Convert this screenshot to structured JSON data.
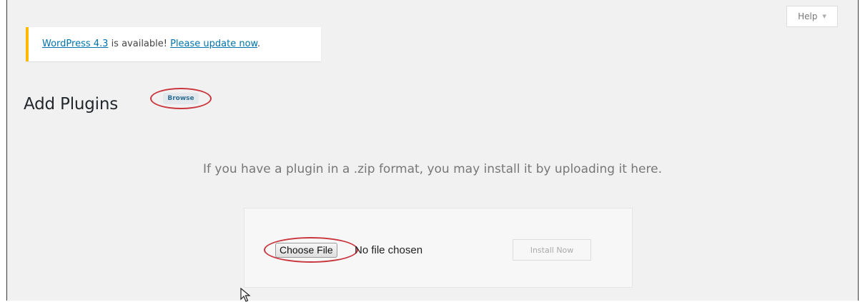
{
  "help_tab": {
    "label": "Help",
    "arrow_icon": "triangle-down-icon"
  },
  "notice": {
    "version_link": "WordPress 4.3",
    "middle_text": " is available! ",
    "update_link": "Please update now",
    "end_text": "."
  },
  "header": {
    "title": "Add Plugins",
    "browse_button": "Browse"
  },
  "upload": {
    "description": "If you have a plugin in a .zip format, you may install it by uploading it here.",
    "choose_file_label": "Choose File",
    "no_file_text": "No file chosen",
    "install_button": "Install Now"
  },
  "colors": {
    "notice_accent": "#ffba00",
    "link": "#0073aa",
    "annotation_ring": "#c9363e",
    "page_background": "#f1f1f1"
  },
  "cursor_icon": "mouse-pointer-icon"
}
